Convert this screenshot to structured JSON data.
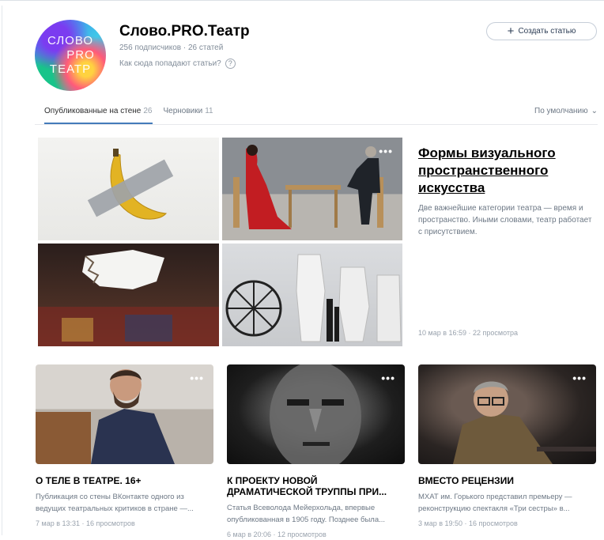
{
  "header": {
    "avatar_lines": [
      "СЛОВО",
      "PRO",
      "ТЕАТР"
    ],
    "title": "Слово.PRO.Театр",
    "stats": "256 подписчиков · 26 статей",
    "how_label": "Как сюда попадают статьи?",
    "help_glyph": "?",
    "create_button": "Создать статью",
    "create_icon": "+"
  },
  "tabs": [
    {
      "label": "Опубликованные на стене",
      "count": "26"
    },
    {
      "label": "Черновики",
      "count": "11"
    }
  ],
  "sort": {
    "label": "По умолчанию",
    "chevron": "⌄"
  },
  "featured": {
    "title": "Формы визуального пространственного искусства",
    "description": "Две важнейшие категории театра — время и пространство. Иными словами, театр работает с присутствием.",
    "meta": "10 мар в 16:59 · 22 просмотра",
    "menu_glyph": "•••"
  },
  "cards": [
    {
      "title": "О ТЕЛЕ В ТЕАТРЕ. 16+",
      "description": "Публикация со стены ВКонтакте одного из ведущих театральных критиков в стране —...",
      "meta": "7 мар в 13:31 · 16 просмотров",
      "menu_glyph": "•••"
    },
    {
      "title": "К ПРОЕКТУ НОВОЙ ДРАМАТИЧЕСКОЙ ТРУППЫ ПРИ...",
      "description": "Статья Всеволода Мейерхольда, впервые опубликованная в 1905 году. Позднее была...",
      "meta": "6 мар в 20:06 · 12 просмотров",
      "menu_glyph": "•••"
    },
    {
      "title": "ВМЕСТО РЕЦЕНЗИИ",
      "description": "МХАТ им. Горького представил премьеру — реконструкцию спектакля «Три сестры» в...",
      "meta": "3 мар в 19:50 · 16 просмотров",
      "menu_glyph": "•••"
    }
  ],
  "colors": {
    "accent": "#447bba",
    "muted": "#818c99",
    "divider": "#e7e8ec"
  }
}
